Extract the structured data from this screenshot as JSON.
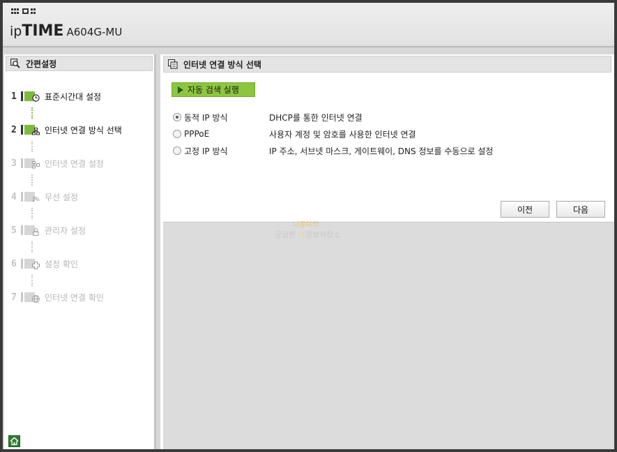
{
  "header": {
    "brand_ip": "ip",
    "brand_time": "TIME",
    "model": "A604G-MU"
  },
  "sidebar": {
    "title": "간편설정",
    "steps": [
      {
        "num": "1",
        "label": "표준시간대 설정",
        "state": "active",
        "icon": "clock-icon"
      },
      {
        "num": "2",
        "label": "인터넷 연결 방식 선택",
        "state": "active",
        "icon": "network-icon"
      },
      {
        "num": "3",
        "label": "인터넷 연결 설정",
        "state": "disabled",
        "icon": "network-settings-icon"
      },
      {
        "num": "4",
        "label": "무선 설정",
        "state": "disabled",
        "icon": "wifi-icon"
      },
      {
        "num": "5",
        "label": "관리자 설정",
        "state": "disabled",
        "icon": "admin-lock-icon"
      },
      {
        "num": "6",
        "label": "설정 확인",
        "state": "disabled",
        "icon": "check-settings-icon"
      },
      {
        "num": "7",
        "label": "인터넷 연결 확인",
        "state": "disabled",
        "icon": "globe-icon"
      }
    ],
    "home_icon": "home-icon"
  },
  "main": {
    "title": "인터넷 연결 방식 선택",
    "auto_detect_label": "자동 검색 실행",
    "options": [
      {
        "name": "동적 IP 방식",
        "desc": "DHCP를 통한 인터넷 연결",
        "checked": true
      },
      {
        "name": "PPPoE",
        "desc": "사용자 계정 및 암호를 사용한 인터넷 연결",
        "checked": false
      },
      {
        "name": "고정 IP 방식",
        "desc": "IP 주소, 서브넷 마스크, 게이트웨이, DNS 정보를 수동으로 설정",
        "checked": false
      }
    ],
    "prev_label": "이전",
    "next_label": "다음"
  },
  "watermark": {
    "line1": "나공이의",
    "line2a": "궁금한 ",
    "line2b": "IT",
    "line2c": "정보저장소"
  },
  "colors": {
    "accent_green": "#8cc63f",
    "active_bar": "#7dbb40",
    "disabled_text": "#b5b5b5"
  }
}
